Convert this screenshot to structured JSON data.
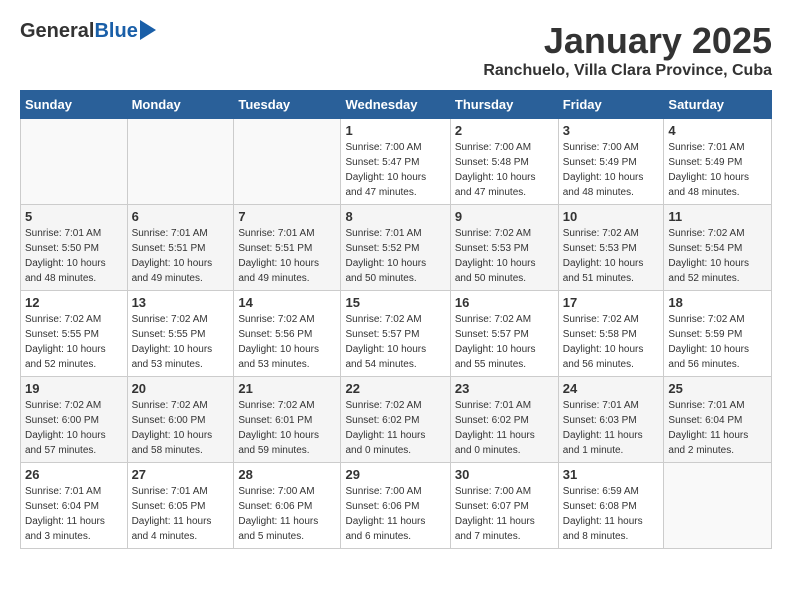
{
  "header": {
    "logo_general": "General",
    "logo_blue": "Blue",
    "month_title": "January 2025",
    "subtitle": "Ranchuelo, Villa Clara Province, Cuba"
  },
  "weekdays": [
    "Sunday",
    "Monday",
    "Tuesday",
    "Wednesday",
    "Thursday",
    "Friday",
    "Saturday"
  ],
  "weeks": [
    [
      {
        "day": "",
        "info": ""
      },
      {
        "day": "",
        "info": ""
      },
      {
        "day": "",
        "info": ""
      },
      {
        "day": "1",
        "info": "Sunrise: 7:00 AM\nSunset: 5:47 PM\nDaylight: 10 hours\nand 47 minutes."
      },
      {
        "day": "2",
        "info": "Sunrise: 7:00 AM\nSunset: 5:48 PM\nDaylight: 10 hours\nand 47 minutes."
      },
      {
        "day": "3",
        "info": "Sunrise: 7:00 AM\nSunset: 5:49 PM\nDaylight: 10 hours\nand 48 minutes."
      },
      {
        "day": "4",
        "info": "Sunrise: 7:01 AM\nSunset: 5:49 PM\nDaylight: 10 hours\nand 48 minutes."
      }
    ],
    [
      {
        "day": "5",
        "info": "Sunrise: 7:01 AM\nSunset: 5:50 PM\nDaylight: 10 hours\nand 48 minutes."
      },
      {
        "day": "6",
        "info": "Sunrise: 7:01 AM\nSunset: 5:51 PM\nDaylight: 10 hours\nand 49 minutes."
      },
      {
        "day": "7",
        "info": "Sunrise: 7:01 AM\nSunset: 5:51 PM\nDaylight: 10 hours\nand 49 minutes."
      },
      {
        "day": "8",
        "info": "Sunrise: 7:01 AM\nSunset: 5:52 PM\nDaylight: 10 hours\nand 50 minutes."
      },
      {
        "day": "9",
        "info": "Sunrise: 7:02 AM\nSunset: 5:53 PM\nDaylight: 10 hours\nand 50 minutes."
      },
      {
        "day": "10",
        "info": "Sunrise: 7:02 AM\nSunset: 5:53 PM\nDaylight: 10 hours\nand 51 minutes."
      },
      {
        "day": "11",
        "info": "Sunrise: 7:02 AM\nSunset: 5:54 PM\nDaylight: 10 hours\nand 52 minutes."
      }
    ],
    [
      {
        "day": "12",
        "info": "Sunrise: 7:02 AM\nSunset: 5:55 PM\nDaylight: 10 hours\nand 52 minutes."
      },
      {
        "day": "13",
        "info": "Sunrise: 7:02 AM\nSunset: 5:55 PM\nDaylight: 10 hours\nand 53 minutes."
      },
      {
        "day": "14",
        "info": "Sunrise: 7:02 AM\nSunset: 5:56 PM\nDaylight: 10 hours\nand 53 minutes."
      },
      {
        "day": "15",
        "info": "Sunrise: 7:02 AM\nSunset: 5:57 PM\nDaylight: 10 hours\nand 54 minutes."
      },
      {
        "day": "16",
        "info": "Sunrise: 7:02 AM\nSunset: 5:57 PM\nDaylight: 10 hours\nand 55 minutes."
      },
      {
        "day": "17",
        "info": "Sunrise: 7:02 AM\nSunset: 5:58 PM\nDaylight: 10 hours\nand 56 minutes."
      },
      {
        "day": "18",
        "info": "Sunrise: 7:02 AM\nSunset: 5:59 PM\nDaylight: 10 hours\nand 56 minutes."
      }
    ],
    [
      {
        "day": "19",
        "info": "Sunrise: 7:02 AM\nSunset: 6:00 PM\nDaylight: 10 hours\nand 57 minutes."
      },
      {
        "day": "20",
        "info": "Sunrise: 7:02 AM\nSunset: 6:00 PM\nDaylight: 10 hours\nand 58 minutes."
      },
      {
        "day": "21",
        "info": "Sunrise: 7:02 AM\nSunset: 6:01 PM\nDaylight: 10 hours\nand 59 minutes."
      },
      {
        "day": "22",
        "info": "Sunrise: 7:02 AM\nSunset: 6:02 PM\nDaylight: 11 hours\nand 0 minutes."
      },
      {
        "day": "23",
        "info": "Sunrise: 7:01 AM\nSunset: 6:02 PM\nDaylight: 11 hours\nand 0 minutes."
      },
      {
        "day": "24",
        "info": "Sunrise: 7:01 AM\nSunset: 6:03 PM\nDaylight: 11 hours\nand 1 minute."
      },
      {
        "day": "25",
        "info": "Sunrise: 7:01 AM\nSunset: 6:04 PM\nDaylight: 11 hours\nand 2 minutes."
      }
    ],
    [
      {
        "day": "26",
        "info": "Sunrise: 7:01 AM\nSunset: 6:04 PM\nDaylight: 11 hours\nand 3 minutes."
      },
      {
        "day": "27",
        "info": "Sunrise: 7:01 AM\nSunset: 6:05 PM\nDaylight: 11 hours\nand 4 minutes."
      },
      {
        "day": "28",
        "info": "Sunrise: 7:00 AM\nSunset: 6:06 PM\nDaylight: 11 hours\nand 5 minutes."
      },
      {
        "day": "29",
        "info": "Sunrise: 7:00 AM\nSunset: 6:06 PM\nDaylight: 11 hours\nand 6 minutes."
      },
      {
        "day": "30",
        "info": "Sunrise: 7:00 AM\nSunset: 6:07 PM\nDaylight: 11 hours\nand 7 minutes."
      },
      {
        "day": "31",
        "info": "Sunrise: 6:59 AM\nSunset: 6:08 PM\nDaylight: 11 hours\nand 8 minutes."
      },
      {
        "day": "",
        "info": ""
      }
    ]
  ]
}
